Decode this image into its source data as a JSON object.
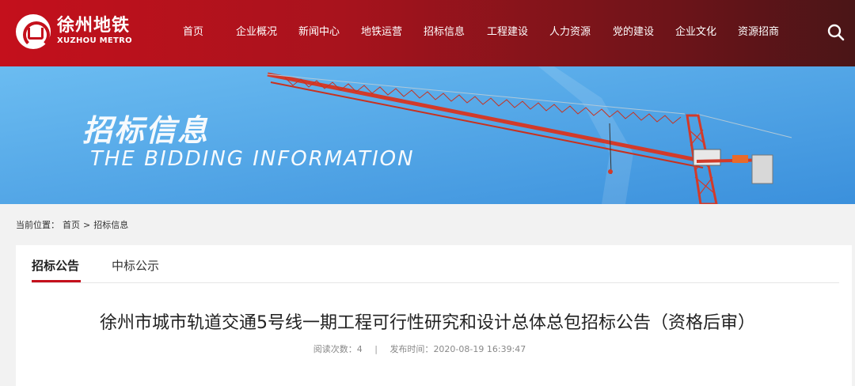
{
  "header": {
    "logo_cn": "徐州地铁",
    "logo_en": "XUZHOU METRO",
    "nav": [
      {
        "label": "首页"
      },
      {
        "label": "企业概况"
      },
      {
        "label": "新闻中心"
      },
      {
        "label": "地铁运营"
      },
      {
        "label": "招标信息"
      },
      {
        "label": "工程建设"
      },
      {
        "label": "人力资源"
      },
      {
        "label": "党的建设"
      },
      {
        "label": "企业文化"
      },
      {
        "label": "资源招商"
      }
    ],
    "search_icon": "search-icon"
  },
  "banner": {
    "title_cn": "招标信息",
    "title_en": "THE BIDDING INFORMATION"
  },
  "breadcrumb": {
    "prefix": "当前位置：",
    "home": "首页",
    "separator": ">",
    "current": "招标信息"
  },
  "tabs": [
    {
      "label": "招标公告",
      "active": true
    },
    {
      "label": "中标公示",
      "active": false
    }
  ],
  "article": {
    "title": "徐州市城市轨道交通5号线一期工程可行性研究和设计总体总包招标公告（资格后审）",
    "views_label": "阅读次数：",
    "views": "4",
    "divider": "|",
    "date_label": "发布时间：",
    "date": "2020-08-19 16:39:47"
  },
  "colors": {
    "brand_red": "#c4101c",
    "banner_blue": "#4aa2e6"
  }
}
